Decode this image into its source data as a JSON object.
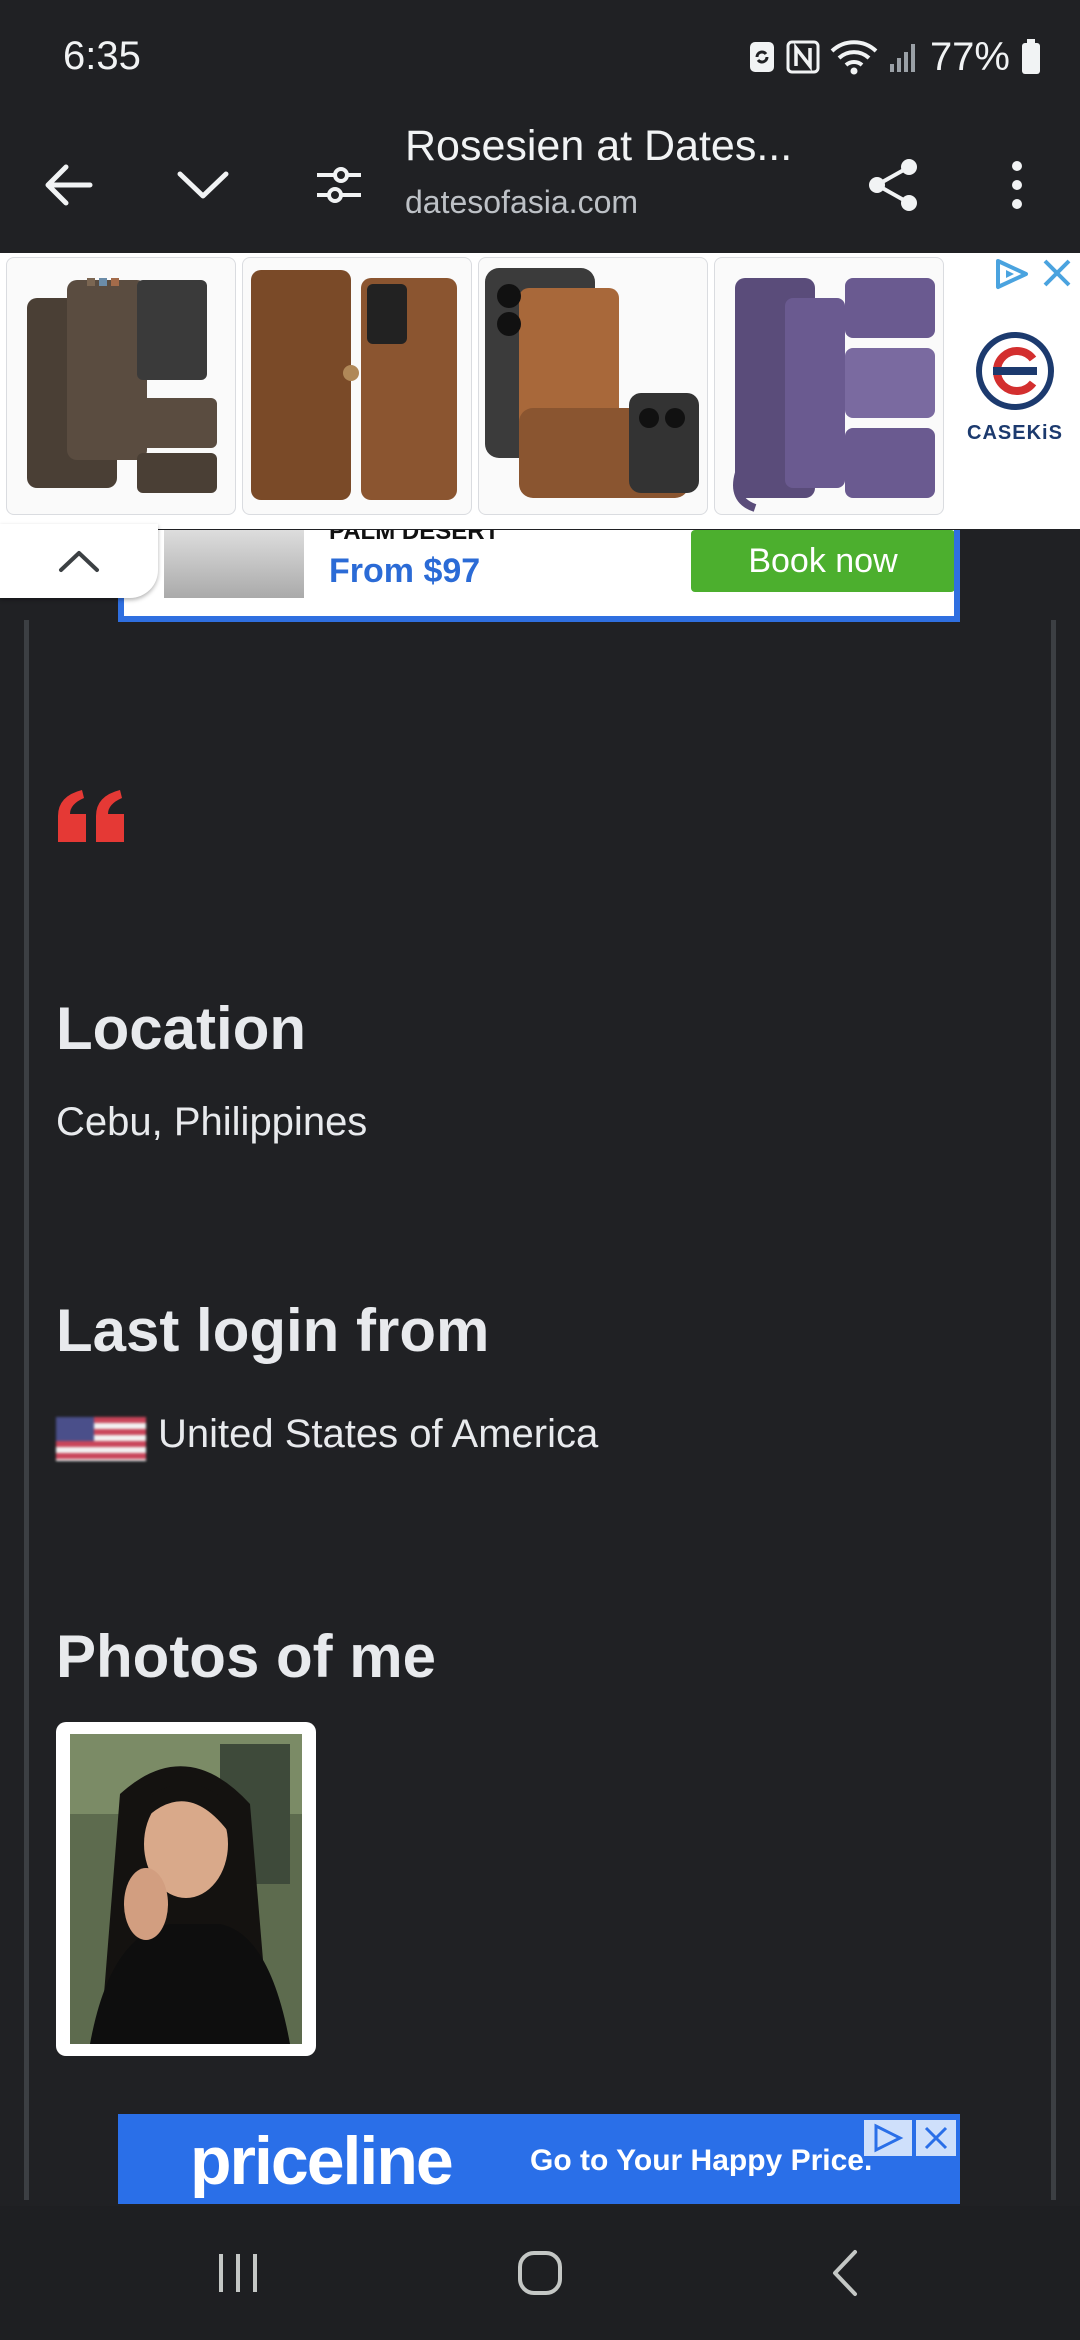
{
  "status_bar": {
    "time": "6:35",
    "battery": "77%"
  },
  "toolbar": {
    "title": "Rosesien at Dates...",
    "url": "datesofasia.com"
  },
  "top_ad": {
    "brand": "CASEKiS"
  },
  "hotel_ad": {
    "subtitle": "PALM DESERT",
    "price": "From $97",
    "button": "Book now"
  },
  "profile": {
    "location_heading": "Location",
    "location_value": "Cebu, Philippines",
    "login_heading": "Last login from",
    "login_value": "United States of America",
    "photos_heading": "Photos of me"
  },
  "bottom_ad": {
    "brand": "priceline",
    "tagline": "Go to Your Happy Price."
  },
  "colors": {
    "background": "#202124",
    "accent_quote": "#e53935",
    "ad_blue": "#2a6fe8",
    "book_green": "#4caf2e"
  }
}
